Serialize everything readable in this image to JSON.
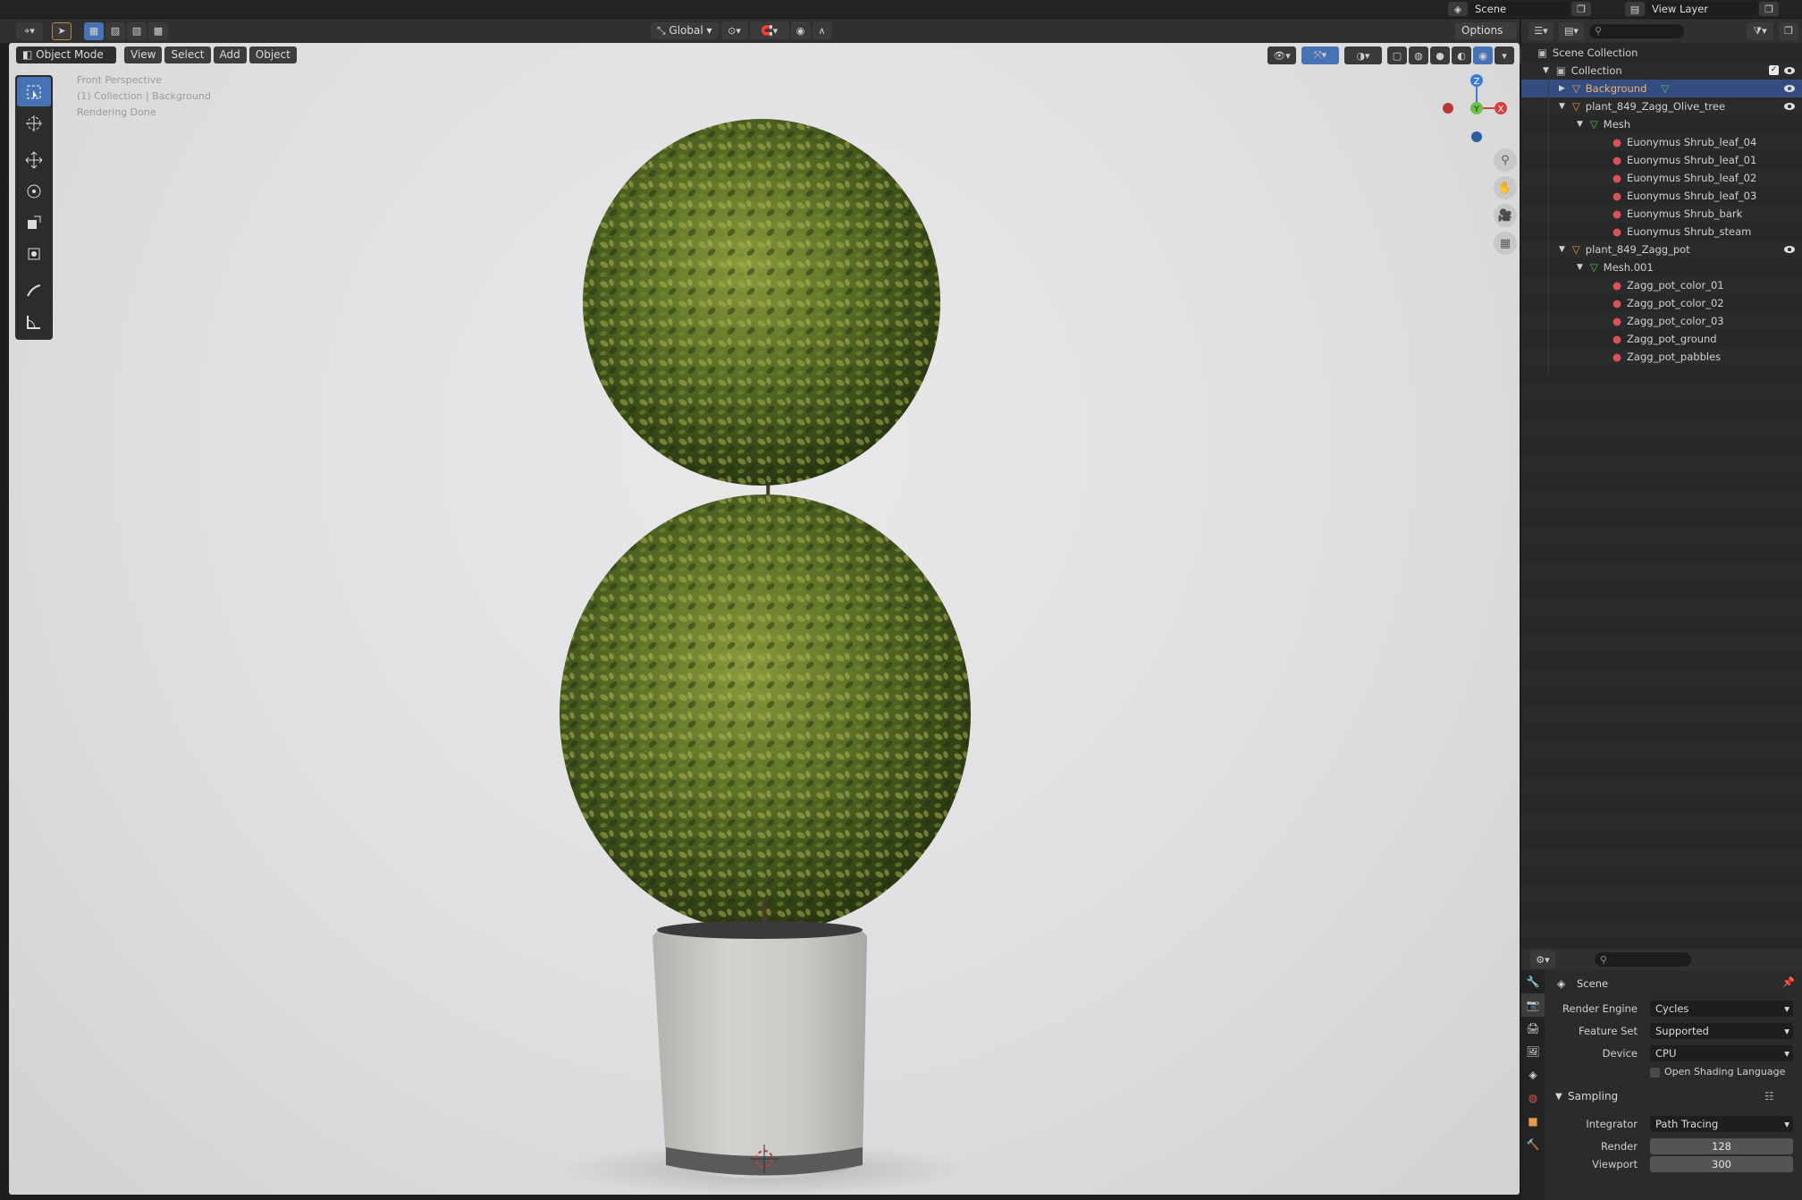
{
  "topbar": {
    "scene": "Scene",
    "view_layer": "View Layer"
  },
  "header": {
    "transform_orientation": "Global",
    "options_label": "Options",
    "mode": "Object Mode",
    "menus": [
      "View",
      "Select",
      "Add",
      "Object"
    ]
  },
  "viewport": {
    "perspective": "Front Perspective",
    "collection_info": "(1) Collection | Background",
    "status": "Rendering Done",
    "gizmo": {
      "x": "X",
      "y": "Y",
      "z": "Z"
    }
  },
  "outliner": {
    "rows": [
      {
        "label": "Scene Collection",
        "type": "scene"
      },
      {
        "label": "Collection",
        "type": "collection"
      },
      {
        "label": "Background",
        "type": "object",
        "selected": true
      },
      {
        "label": "plant_849_Zagg_Olive_tree",
        "type": "object"
      },
      {
        "label": "Mesh",
        "type": "mesh"
      },
      {
        "label": "Euonymus Shrub_leaf_04",
        "type": "material"
      },
      {
        "label": "Euonymus Shrub_leaf_01",
        "type": "material"
      },
      {
        "label": "Euonymus Shrub_leaf_02",
        "type": "material"
      },
      {
        "label": "Euonymus Shrub_leaf_03",
        "type": "material"
      },
      {
        "label": "Euonymus Shrub_bark",
        "type": "material"
      },
      {
        "label": "Euonymus Shrub_steam",
        "type": "material"
      },
      {
        "label": "plant_849_Zagg_pot",
        "type": "object"
      },
      {
        "label": "Mesh.001",
        "type": "mesh"
      },
      {
        "label": "Zagg_pot_color_01",
        "type": "material"
      },
      {
        "label": "Zagg_pot_color_02",
        "type": "material"
      },
      {
        "label": "Zagg_pot_color_03",
        "type": "material"
      },
      {
        "label": "Zagg_pot_ground",
        "type": "material"
      },
      {
        "label": "Zagg_pot_pabbles",
        "type": "material"
      }
    ]
  },
  "properties": {
    "context": "Scene",
    "render_engine_label": "Render Engine",
    "render_engine": "Cycles",
    "feature_set_label": "Feature Set",
    "feature_set": "Supported",
    "device_label": "Device",
    "device": "CPU",
    "osl_label": "Open Shading Language",
    "sampling_label": "Sampling",
    "integrator_label": "Integrator",
    "integrator": "Path Tracing",
    "render_label": "Render",
    "render_samples": "128",
    "viewport_label": "Viewport",
    "viewport_samples": "300"
  },
  "colors": {
    "accent": "#4772b3",
    "selected_row": "#334d80",
    "object_orange": "#e59a4c",
    "mesh_green": "#5fb56a",
    "material_red": "#d8535a"
  }
}
